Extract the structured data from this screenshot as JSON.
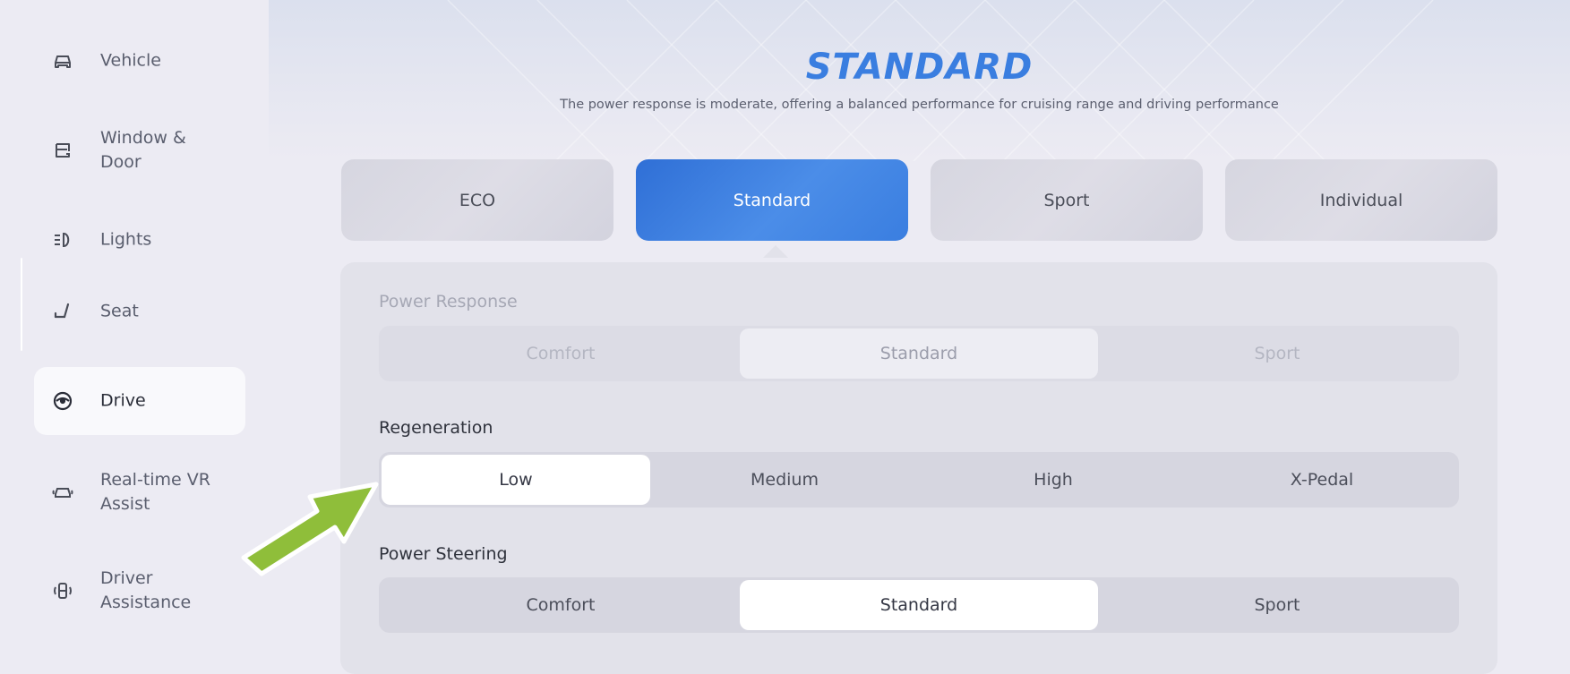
{
  "sidebar": {
    "items": [
      {
        "label": "Vehicle",
        "icon": "car-icon",
        "active": false
      },
      {
        "label": "Window &\nDoor",
        "icon": "door-icon",
        "active": false
      },
      {
        "label": "Lights",
        "icon": "headlight-icon",
        "active": false
      },
      {
        "label": "Seat",
        "icon": "seat-icon",
        "active": false
      },
      {
        "label": "Drive",
        "icon": "steering-wheel-icon",
        "active": true
      },
      {
        "label": "Real-time VR\nAssist",
        "icon": "vr-assist-icon",
        "active": false
      },
      {
        "label": "Driver\nAssistance",
        "icon": "driver-assistance-icon",
        "active": false
      }
    ]
  },
  "header": {
    "title": "STANDARD",
    "subtitle": "The power response is moderate, offering a balanced performance for cruising range and driving performance"
  },
  "modes": {
    "tabs": [
      "ECO",
      "Standard",
      "Sport",
      "Individual"
    ],
    "selected": "Standard"
  },
  "power_response": {
    "label": "Power Response",
    "options": [
      "Comfort",
      "Standard",
      "Sport"
    ],
    "selected": "Standard"
  },
  "regeneration": {
    "label": "Regeneration",
    "options": [
      "Low",
      "Medium",
      "High",
      "X-Pedal"
    ],
    "selected": "Low"
  },
  "power_steering": {
    "label": "Power Steering",
    "options": [
      "Comfort",
      "Standard",
      "Sport"
    ],
    "selected": "Standard"
  },
  "colors": {
    "accent": "#3a7ee0",
    "arrow": "#8fbe3a"
  }
}
